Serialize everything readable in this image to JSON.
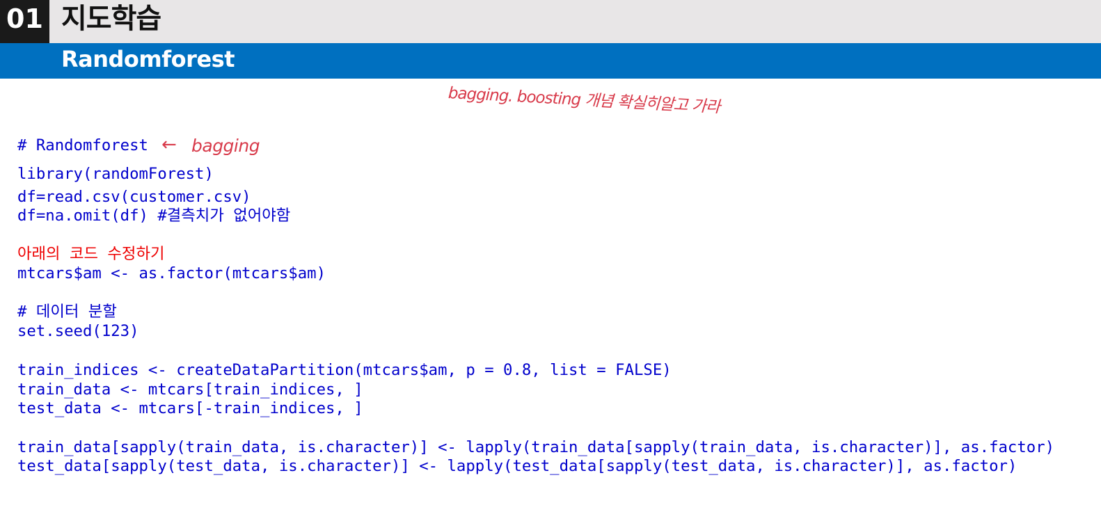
{
  "header": {
    "number": "01",
    "title": "지도학습",
    "subtitle": "Randomforest"
  },
  "annotations": {
    "top_note": "bagging. boosting 개념 확실히알고 가라",
    "arrow": "←",
    "side_note": "bagging"
  },
  "code": {
    "lines": [
      "# Randomforest",
      "library(randomForest)",
      "df=read.csv(customer.csv)",
      "df=na.omit(df) #결측치가 없어야함",
      "아래의 코드 수정하기",
      "mtcars$am <- as.factor(mtcars$am)",
      "# 데이터 분할",
      "set.seed(123)",
      "train_indices <- createDataPartition(mtcars$am, p = 0.8, list = FALSE)",
      "train_data <- mtcars[train_indices, ]",
      "test_data <- mtcars[-train_indices, ]",
      "train_data[sapply(train_data, is.character)] <- lapply(train_data[sapply(train_data, is.character)], as.factor)",
      "test_data[sapply(test_data, is.character)] <- lapply(test_data[sapply(test_data, is.character)], as.factor)"
    ]
  },
  "colors": {
    "header_bg": "#e8e6e7",
    "number_bg": "#1a1a1a",
    "subtitle_bar": "#0070c0",
    "code_text": "#0000cc",
    "highlight_text": "#ee0000",
    "handwriting": "#d83a4a"
  }
}
